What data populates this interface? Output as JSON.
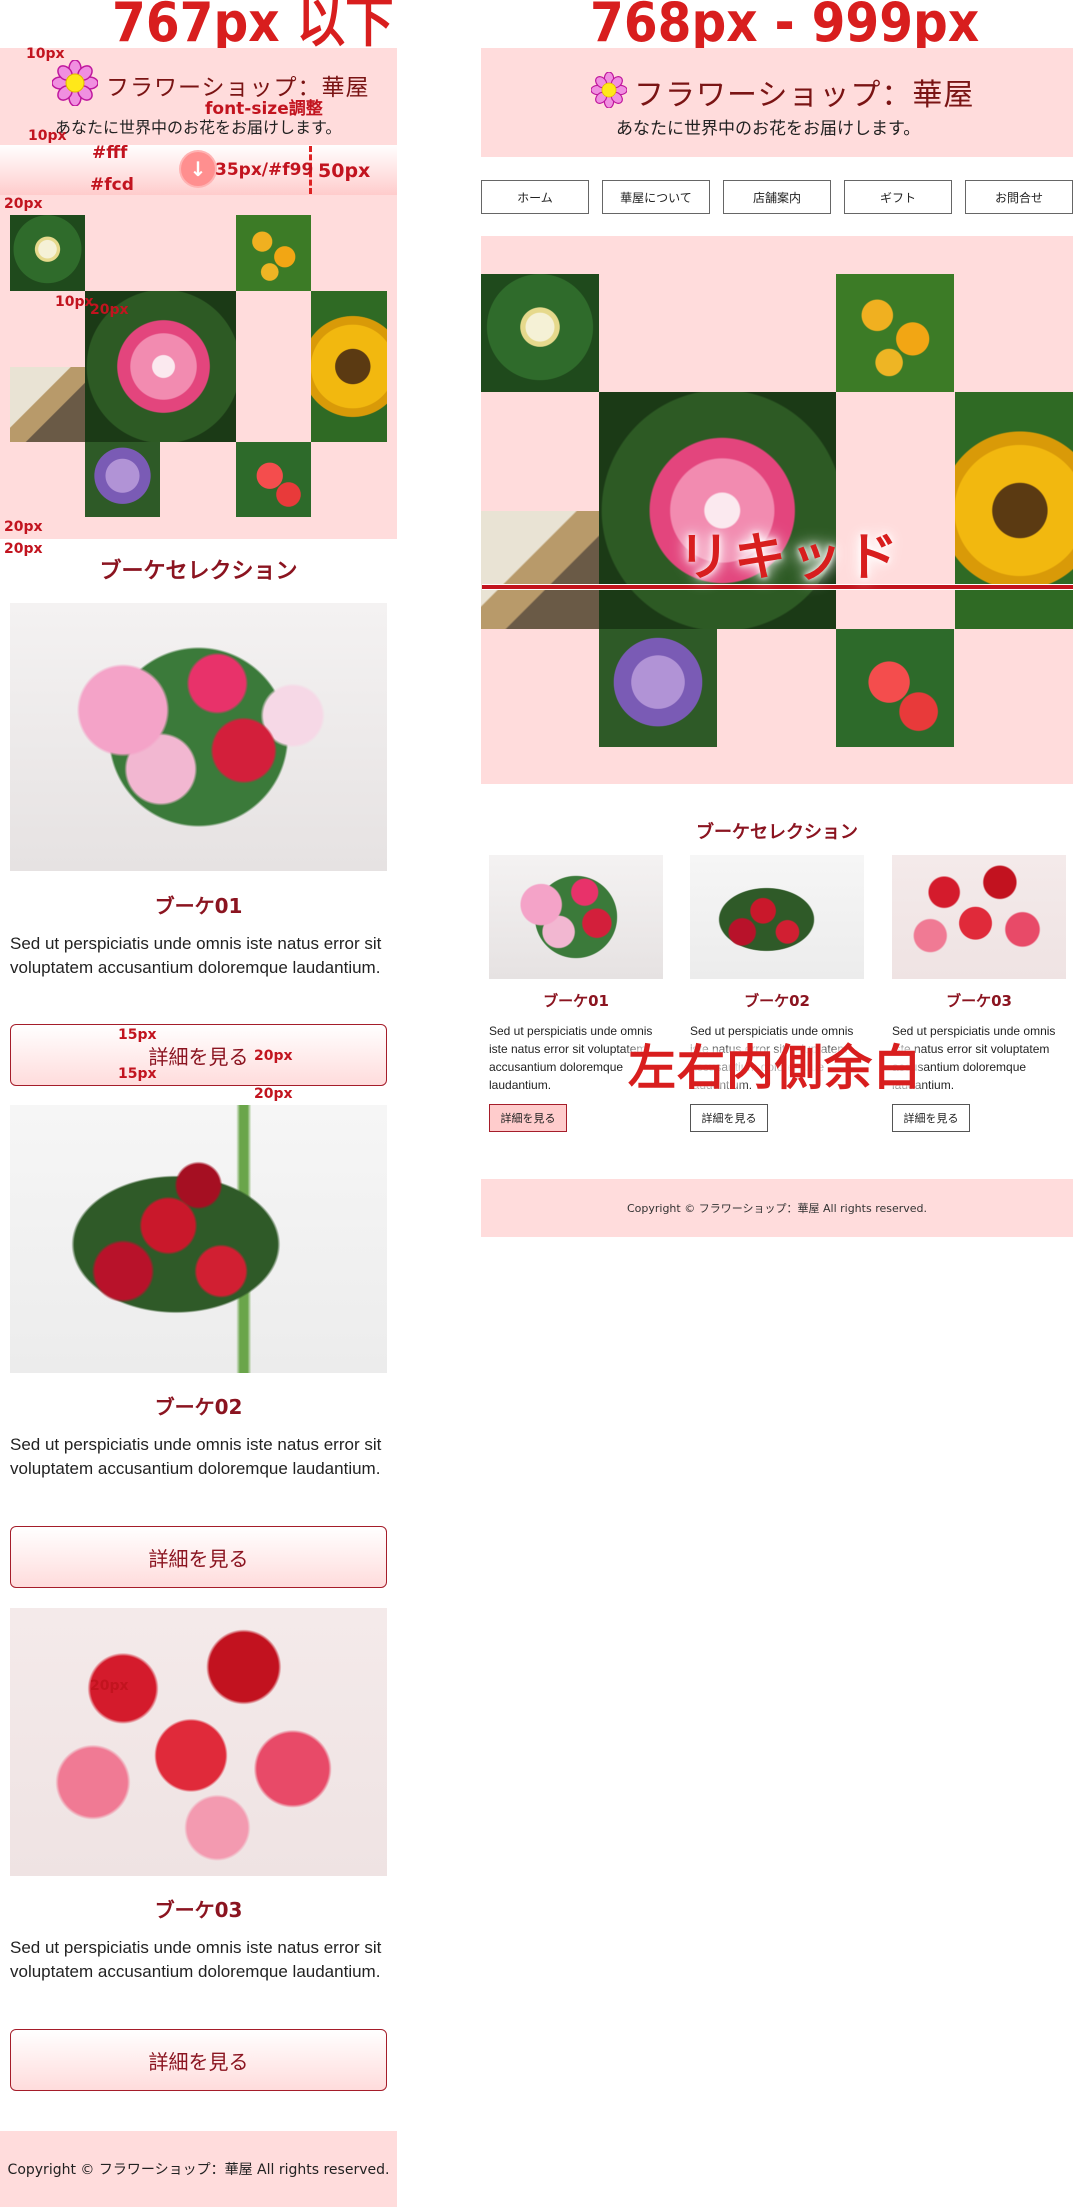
{
  "mobile": {
    "heading": "767px 以下",
    "site_title": "フラワーショップ：華屋",
    "site_subtitle": "あなたに世界中のお花をお届けします。",
    "section_title": "ブーケセレクション",
    "cards": [
      {
        "title": "ブーケ01",
        "text": "Sed ut perspiciatis unde omnis iste natus error sit voluptatem accusantium doloremque laudantium.",
        "button": "詳細を見る"
      },
      {
        "title": "ブーケ02",
        "text": "Sed ut perspiciatis unde omnis iste natus error sit voluptatem accusantium doloremque laudantium.",
        "button": "詳細を見る"
      },
      {
        "title": "ブーケ03",
        "text": "Sed ut perspiciatis unde omnis iste natus error sit voluptatem accusantium doloremque laudantium.",
        "button": "詳細を見る"
      }
    ],
    "footer": "Copyright © フラワーショップ：華屋 All rights reserved."
  },
  "tablet": {
    "heading": "768px - 999px",
    "site_title": "フラワーショップ：華屋",
    "site_subtitle": "あなたに世界中のお花をお届けします。",
    "nav": [
      "ホーム",
      "華屋について",
      "店舗案内",
      "ギフト",
      "お問合せ"
    ],
    "section_title": "ブーケセレクション",
    "cards": [
      {
        "title": "ブーケ01",
        "text": "Sed ut perspiciatis unde omnis iste natus error sit voluptatem accusantium doloremque laudantium.",
        "button": "詳細を見る"
      },
      {
        "title": "ブーケ02",
        "text": "Sed ut perspiciatis unde omnis iste natus error sit voluptatem accusantium doloremque laudantium.",
        "button": "詳細を見る"
      },
      {
        "title": "ブーケ03",
        "text": "Sed ut perspiciatis unde omnis iste natus error sit voluptatem accusantium doloremque laudantium.",
        "button": "詳細を見る"
      }
    ],
    "footer": "Copyright © フラワーショップ：華屋 All rights reserved."
  },
  "annotations": {
    "p10_a": "10px",
    "font_size": "font-size調整",
    "p10_b": "10px",
    "color_white": "#fff",
    "color_pink": "#fcd",
    "button_spec": "35px/#f99",
    "p50": "50px",
    "p20_a": "20px",
    "p10_c": "10px",
    "p20_b": "20px",
    "p20_c": "20px",
    "p20_d": "20px",
    "p15_a": "15px",
    "p20_e": "20px",
    "p15_b": "15px",
    "p20_f": "20px",
    "p20_g": "20px",
    "liquid": "リキッド",
    "inner_margin": "左右内側余白"
  },
  "icons": {
    "logo": "flower-logo-icon",
    "scroll": "arrow-down-icon"
  },
  "colors": {
    "accent": "#d81e1e",
    "header_bg": "#ffdcdc",
    "title": "#8b1420",
    "button_circle": "#ff9999"
  }
}
